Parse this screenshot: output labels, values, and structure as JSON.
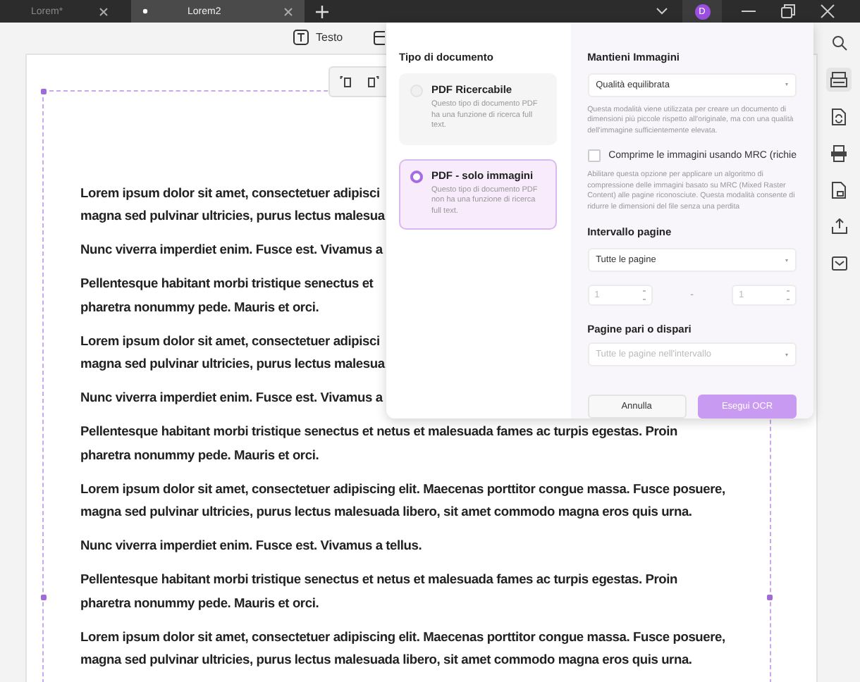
{
  "tabs": [
    {
      "label": "Lorem*",
      "selected": false
    },
    {
      "label": "Lorem2",
      "selected": true
    }
  ],
  "user": {
    "initial": "D"
  },
  "toolbar": [
    {
      "label": "Testo"
    }
  ],
  "document": {
    "paragraphs": [
      {
        "lines": [
          "Lorem ipsum dolor sit amet, consectetuer adipisci",
          "magna sed pulvinar ultricies, purus lectus malesua"
        ]
      },
      {
        "lines": [
          "Nunc viverra imperdiet enim. Fusce est. Vivamus a"
        ]
      },
      {
        "lines": [
          "Pellentesque habitant morbi tristique senectus et",
          "pharetra nonummy pede. Mauris et orci."
        ]
      },
      {
        "lines": [
          "Lorem ipsum dolor sit amet, consectetuer adipisci",
          "magna sed pulvinar ultricies, purus lectus malesua"
        ]
      },
      {
        "lines": [
          "Nunc viverra imperdiet enim. Fusce est. Vivamus a"
        ]
      },
      {
        "lines": [
          "Pellentesque habitant morbi tristique senectus et netus et malesuada fames ac turpis egestas. Proin",
          "pharetra nonummy pede. Mauris et orci."
        ]
      },
      {
        "lines": [
          "Lorem ipsum dolor sit amet, consectetuer adipiscing elit. Maecenas porttitor congue massa. Fusce posuere,",
          "magna sed pulvinar ultricies, purus lectus malesuada libero, sit amet commodo magna eros quis urna."
        ]
      },
      {
        "lines": [
          "Nunc viverra imperdiet enim. Fusce est. Vivamus a tellus."
        ]
      },
      {
        "lines": [
          "Pellentesque habitant morbi tristique senectus et netus et malesuada fames ac turpis egestas. Proin",
          "pharetra nonummy pede. Mauris et orci."
        ]
      },
      {
        "lines": [
          "Lorem ipsum dolor sit amet, consectetuer adipiscing elit. Maecenas porttitor congue massa. Fusce posuere,",
          "magna sed pulvinar ultricies, purus lectus malesuada libero, sit amet commodo magna eros quis urna."
        ]
      }
    ]
  },
  "sidebar": {
    "items": [
      {
        "kind": "search",
        "selected": false
      },
      {
        "kind": "ocr",
        "selected": true
      },
      {
        "kind": "convert",
        "selected": false
      },
      {
        "kind": "pdf",
        "selected": false
      },
      {
        "kind": "protect",
        "selected": false
      },
      {
        "kind": "share",
        "selected": false
      },
      {
        "kind": "mail",
        "selected": false
      }
    ]
  },
  "ocr_dialog": {
    "document_type": {
      "title": "Tipo di documento",
      "options": [
        {
          "title": "PDF Ricercabile",
          "description": "Questo tipo di documento PDF ha una funzione di ricerca full text.",
          "selected": false
        },
        {
          "title": "PDF - solo immagini",
          "description": "Questo tipo di documento PDF non ha una funzione di ricerca full text.",
          "selected": true
        }
      ]
    },
    "keep_images": {
      "title": "Mantieni Immagini",
      "value": "Qualità equilibrata",
      "description": "Questa modalità viene utilizzata per creare un documento di dimensioni più piccole rispetto all'originale, ma con una qualità dell'immagine sufficientemente elevata."
    },
    "mrc": {
      "label": "Comprime le immagini usando MRC (richie",
      "checked": false,
      "description": "Abilitare questa opzione per applicare un algoritmo di compressione delle immagini basato su MRC (Mixed Raster Content) alle pagine riconosciute. Questa modalità consente di ridurre le dimensioni del file senza una perdita"
    },
    "page_range": {
      "title": "Intervallo pagine",
      "value": "Tutte le pagine",
      "from": "1",
      "separator": "-",
      "to": "1"
    },
    "odd_even": {
      "title": "Pagine pari o dispari",
      "placeholder": "Tutte le pagine nell'intervallo"
    },
    "buttons": [
      {
        "label": "Annulla",
        "kind": "secondary"
      },
      {
        "label": "Esegui OCR",
        "kind": "primary"
      }
    ]
  }
}
